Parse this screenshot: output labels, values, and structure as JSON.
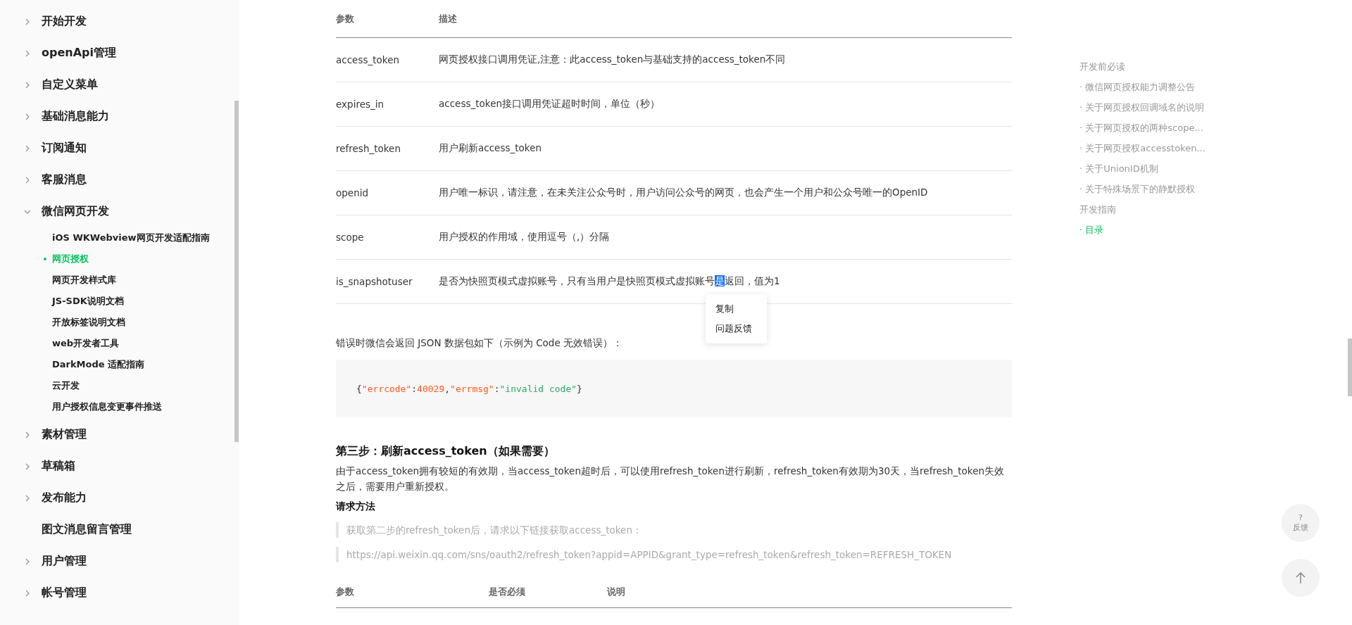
{
  "sidebar": {
    "items": [
      {
        "label": "开始开发",
        "kind": "group",
        "expanded": false
      },
      {
        "label": "openApi管理",
        "kind": "group",
        "expanded": false
      },
      {
        "label": "自定义菜单",
        "kind": "group",
        "expanded": false
      },
      {
        "label": "基础消息能力",
        "kind": "group",
        "expanded": false
      },
      {
        "label": "订阅通知",
        "kind": "group",
        "expanded": false
      },
      {
        "label": "客服消息",
        "kind": "group",
        "expanded": false
      },
      {
        "label": "微信网页开发",
        "kind": "group",
        "expanded": true,
        "children": [
          {
            "label": "iOS WKWebview网页开发适配指南",
            "selected": false
          },
          {
            "label": "网页授权",
            "selected": true
          },
          {
            "label": "网页开发样式库",
            "selected": false
          },
          {
            "label": "JS-SDK说明文档",
            "selected": false
          },
          {
            "label": "开放标签说明文档",
            "selected": false
          },
          {
            "label": "web开发者工具",
            "selected": false
          },
          {
            "label": "DarkMode 适配指南",
            "selected": false
          },
          {
            "label": "云开发",
            "selected": false
          },
          {
            "label": "用户授权信息变更事件推送",
            "selected": false
          }
        ]
      },
      {
        "label": "素材管理",
        "kind": "group",
        "expanded": false
      },
      {
        "label": "草稿箱",
        "kind": "group",
        "expanded": false
      },
      {
        "label": "发布能力",
        "kind": "group",
        "expanded": false
      },
      {
        "label": "图文消息留言管理",
        "kind": "link"
      },
      {
        "label": "用户管理",
        "kind": "group",
        "expanded": false
      },
      {
        "label": "帐号管理",
        "kind": "group",
        "expanded": false
      }
    ]
  },
  "params_table": {
    "columns": [
      "参数",
      "描述"
    ],
    "rows": [
      {
        "cells": [
          {
            "text": "access_token"
          },
          {
            "parts": [
              {
                "text": "网页授权接口调用凭证,注意：此access_token与基础支持的access_token不同",
                "selected": false
              }
            ]
          }
        ]
      },
      {
        "cells": [
          {
            "text": "expires_in"
          },
          {
            "parts": [
              {
                "text": "access_token接口调用凭证超时时间，单位（秒）",
                "selected": false
              }
            ]
          }
        ]
      },
      {
        "cells": [
          {
            "text": "refresh_token"
          },
          {
            "parts": [
              {
                "text": "用户刷新access_token",
                "selected": false
              }
            ]
          }
        ]
      },
      {
        "cells": [
          {
            "text": "openid"
          },
          {
            "parts": [
              {
                "text": "用户唯一标识，请注意，在未关注公众号时，用户访问公众号的网页，也会产生一个用户和公众号唯一的OpenID",
                "selected": false
              }
            ]
          }
        ]
      },
      {
        "cells": [
          {
            "text": "scope"
          },
          {
            "parts": [
              {
                "text": "用户授权的作用域，使用逗号（,）分隔",
                "selected": false
              }
            ]
          }
        ]
      },
      {
        "cells": [
          {
            "text": "is_snapshotuser"
          },
          {
            "parts": [
              {
                "text": "是否为快照页模式虚拟账号，只有当用户是快照页模式虚拟账号",
                "selected": false
              },
              {
                "text": "是",
                "selected": true
              },
              {
                "text": "返回，值为1",
                "selected": false
              }
            ]
          }
        ]
      }
    ]
  },
  "context_menu": {
    "items": [
      "复制",
      "问题反馈"
    ]
  },
  "error_intro": "错误时微信会返回 JSON 数据包如下（示例为 Code 无效错误）：",
  "code_block": {
    "tokens": [
      {
        "text": "{",
        "kind": "punct"
      },
      {
        "text": "\"errcode\"",
        "kind": "key"
      },
      {
        "text": ":",
        "kind": "punct"
      },
      {
        "text": "40029",
        "kind": "number"
      },
      {
        "text": ",",
        "kind": "punct"
      },
      {
        "text": "\"errmsg\"",
        "kind": "key"
      },
      {
        "text": ":",
        "kind": "punct"
      },
      {
        "text": "\"invalid code\"",
        "kind": "string"
      },
      {
        "text": "}",
        "kind": "punct"
      }
    ]
  },
  "step3": {
    "heading": "第三步：刷新access_token（如果需要）",
    "paragraph": "由于access_token拥有较短的有效期，当access_token超时后，可以使用refresh_token进行刷新，refresh_token有效期为30天，当refresh_token失效之后，需要用户重新授权。",
    "method_label": "请求方法",
    "quotes": [
      "获取第二步的refresh_token后，请求以下链接获取access_token：",
      "https://api.weixin.qq.com/sns/oauth2/refresh_token?appid=APPID&grant_type=refresh_token&refresh_token=REFRESH_TOKEN"
    ],
    "table": {
      "columns": [
        "参数",
        "是否必须",
        "说明"
      ]
    }
  },
  "toc": {
    "items": [
      {
        "label": "开发前必读",
        "selected": false
      },
      {
        "label": "· 微信网页授权能力调整公告",
        "selected": false
      },
      {
        "label": "· 关于网页授权回调域名的说明",
        "selected": false
      },
      {
        "label": "· 关于网页授权的两种scope...",
        "selected": false
      },
      {
        "label": "· 关于网页授权accesstoken...",
        "selected": false
      },
      {
        "label": "· 关于UnionID机制",
        "selected": false
      },
      {
        "label": "· 关于特殊场景下的静默授权",
        "selected": false
      },
      {
        "label": "开发指南",
        "selected": false
      },
      {
        "label": "· 目录",
        "selected": true
      }
    ]
  },
  "feedback_button": {
    "icon_char": "?",
    "label": "反馈"
  }
}
